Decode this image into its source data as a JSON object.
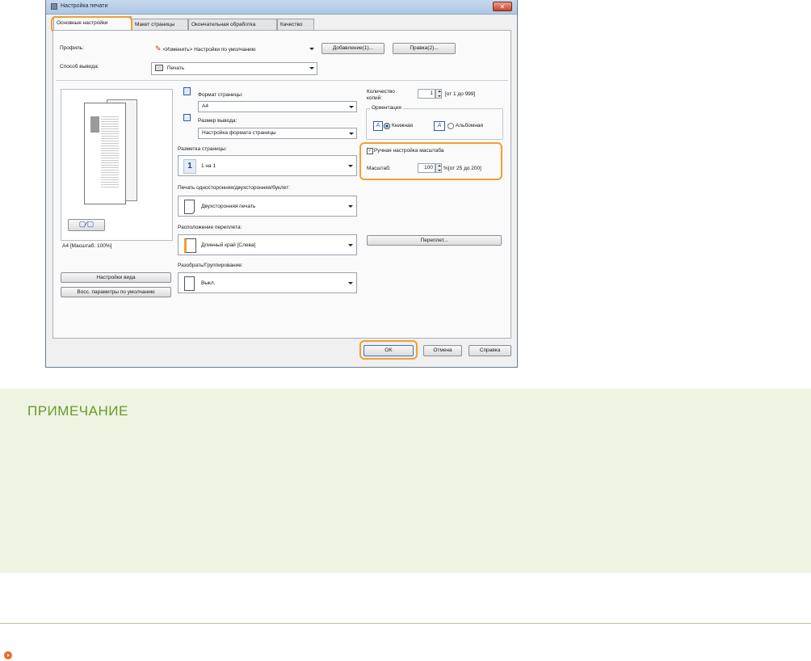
{
  "dialog": {
    "title": "Настройка печати",
    "close": "✕",
    "tabs": [
      {
        "label": "Основные настройки",
        "active": true
      },
      {
        "label": "Макет страницы"
      },
      {
        "label": "Окончательная обработка"
      },
      {
        "label": "Качество"
      }
    ],
    "profile": {
      "label": "Профиль:",
      "value": "<Изменить> Настройки по умолчанию",
      "add_button": "Добавление(1)...",
      "edit_button": "Правка(2)..."
    },
    "output_method": {
      "label": "Способ вывода:",
      "value": "Печать"
    },
    "preview": {
      "caption": "A4 [Масштаб: 100%]"
    },
    "view_settings_button": "Настройки вида",
    "restore_defaults_button": "Восс. параметры по умолчанию",
    "page_size": {
      "label": "Формат страницы:",
      "value": "A4"
    },
    "output_size": {
      "label": "Размер вывода:",
      "value": "Настройка формата страницы"
    },
    "page_layout": {
      "label": "Разметка страницы:",
      "value": "1 на 1",
      "icon_text": "1"
    },
    "duplex": {
      "label": "Печать односторонняя/двухсторонняя/буклет:",
      "value": "Двухсторонняя печать"
    },
    "binding_location": {
      "label": "Расположение переплета:",
      "value": "Длинный край [Слева]"
    },
    "collate": {
      "label": "Разобрать/Группирование:",
      "value": "Выкл."
    },
    "copies": {
      "label_line1": "Количество",
      "label_line2": "копий:",
      "value": "1",
      "range": "[от 1 до 999]"
    },
    "orientation": {
      "label": "Ориентация",
      "icon_text": "A",
      "portrait": "Книжная",
      "landscape": "Альбомная",
      "selected": "portrait"
    },
    "manual_scaling": {
      "label": "Ручная настройка масштаба",
      "checked": true
    },
    "scale": {
      "label": "Масштаб:",
      "value": "100",
      "unit": "%",
      "range": "[от 25 до 200]"
    },
    "gutter_button": "Переплет...",
    "ok_button": "OK",
    "cancel_button": "Отмена",
    "help_button": "Справка",
    "highlight_color": "#f0a030"
  },
  "note": {
    "title": "ПРИМЕЧАНИЕ",
    "background": "#eef3e2",
    "title_color": "#6a9a2a"
  },
  "footer": {
    "icon": "orange-arrow-circle-icon"
  }
}
